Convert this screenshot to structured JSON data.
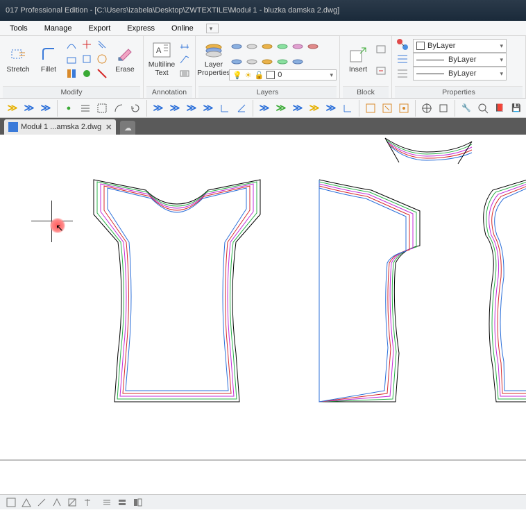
{
  "title": "017 Professional Edition - [C:\\Users\\izabela\\Desktop\\ZWTEXTILE\\Moduł 1 - bluzka damska 2.dwg]",
  "menu": {
    "tools": "Tools",
    "manage": "Manage",
    "export": "Export",
    "express": "Express",
    "online": "Online"
  },
  "ribbon": {
    "modify": "Modify",
    "annotation": "Annotation",
    "layers": "Layers",
    "block": "Block",
    "properties": "Properties",
    "stretch": "Stretch",
    "fillet": "Fillet",
    "erase": "Erase",
    "mtext": "Multiline\nText",
    "layerprops": "Layer\nProperties",
    "insert": "Insert",
    "layer_current": "0",
    "bylayer1": "ByLayer",
    "bylayer2": "ByLayer",
    "bylayer3": "ByLayer"
  },
  "tab": {
    "label": "Moduł 1 ...amska 2.dwg",
    "close": "✕"
  },
  "colors": {
    "outer": "#000000",
    "c1": "#2bb04a",
    "c2": "#c22bd8",
    "c3": "#d62b2b",
    "c4": "#2b6fd9",
    "c5": "#e6a400"
  }
}
